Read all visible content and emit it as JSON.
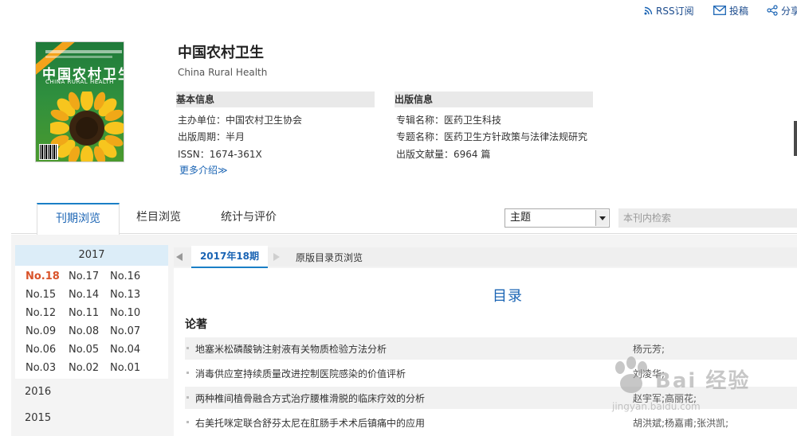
{
  "toplinks": {
    "rss": "RSS订阅",
    "submit": "投稿",
    "share": "分享"
  },
  "cover": {
    "title": "中国农村卫生",
    "subtitle": "CHINA RURAL HEALTH"
  },
  "journal": {
    "title": "中国农村卫生",
    "title_en": "China Rural Health"
  },
  "basic_info": {
    "heading": "基本信息",
    "sponsor": "主办单位：中国农村卫生协会",
    "cycle": "出版周期：半月",
    "issn": "ISSN：1674-361X",
    "more": "更多介绍≫"
  },
  "pub_info": {
    "heading": "出版信息",
    "category": "专辑名称：医药卫生科技",
    "topic": "专题名称：医药卫生方针政策与法律法规研究",
    "count": "出版文献量：6964 篇"
  },
  "tabs": [
    {
      "label": "刊期浏览",
      "active": true
    },
    {
      "label": "栏目浏览",
      "active": false
    },
    {
      "label": "统计与评价",
      "active": false
    }
  ],
  "search": {
    "field": "主题",
    "placeholder": "本刊内检索"
  },
  "sidebar": {
    "current_year": "2017",
    "issues": [
      [
        "No.18",
        "No.17",
        "No.16"
      ],
      [
        "No.15",
        "No.14",
        "No.13"
      ],
      [
        "No.12",
        "No.11",
        "No.10"
      ],
      [
        "No.09",
        "No.08",
        "No.07"
      ],
      [
        "No.06",
        "No.05",
        "No.04"
      ],
      [
        "No.03",
        "No.02",
        "No.01"
      ]
    ],
    "selected_issue": "No.18",
    "other_years": [
      "2016",
      "2015"
    ]
  },
  "main": {
    "issue_tab": "2017年18期",
    "original_link": "原版目录页浏览",
    "toc_title": "目录",
    "section": "论著",
    "articles": [
      {
        "title": "地塞米松磷酸钠注射液有关物质检验方法分析",
        "authors": "杨元芳;"
      },
      {
        "title": "消毒供应室持续质量改进控制医院感染的价值评析",
        "authors": "刘凌华;"
      },
      {
        "title": "两种椎间植骨融合方式治疗腰椎滑脱的临床疗效的分析",
        "authors": "赵宇军;高丽花;"
      },
      {
        "title": "右美托咪定联合舒芬太尼在肛肠手术术后镇痛中的应用",
        "authors": "胡洪斌;杨嘉甫;张洪凯;"
      }
    ]
  },
  "watermark": {
    "text": "Bai 经验",
    "sub": "jingyan.baidu.com"
  },
  "colors": {
    "accent": "#1a64b4",
    "tab_border": "#1a7fc6",
    "selected_issue": "#d9532a",
    "year_head_bg": "#dcedf8"
  }
}
